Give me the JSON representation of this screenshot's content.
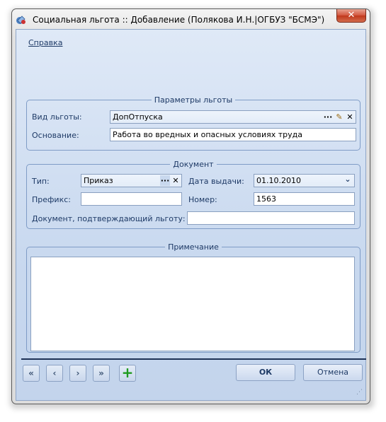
{
  "window": {
    "title": "Социальная льгота :: Добавление  (Полякова И.Н.|ОГБУЗ \"БСМЭ\")",
    "close_glyph": "✕"
  },
  "menu": {
    "help": "Справка"
  },
  "benefit_params": {
    "legend": "Параметры льготы",
    "type_label": "Вид льготы:",
    "type_value": "ДопОтпуска",
    "basis_label": "Основание:",
    "basis_value": "Работа во вредных и опасных условиях труда"
  },
  "document": {
    "legend": "Документ",
    "type_label": "Тип:",
    "type_value": "Приказ",
    "issue_date_label": "Дата выдачи:",
    "issue_date_value": "01.10.2010",
    "prefix_label": "Префикс:",
    "prefix_value": "",
    "number_label": "Номер:",
    "number_value": "1563",
    "confirm_label": "Документ, подтверждающий льготу:",
    "confirm_value": ""
  },
  "note": {
    "legend": "Примечание",
    "value": ""
  },
  "navigation": {
    "first": "«",
    "prev": "‹",
    "next": "›",
    "last": "»",
    "add": "+"
  },
  "buttons": {
    "ok": "ОК",
    "cancel": "Отмена"
  },
  "icons": {
    "ellipsis": "···",
    "edit": "✎",
    "clear": "✕",
    "dropdown": "⌄"
  },
  "colors": {
    "accent": "#1e3a66",
    "add_green": "#1f9a1f"
  }
}
